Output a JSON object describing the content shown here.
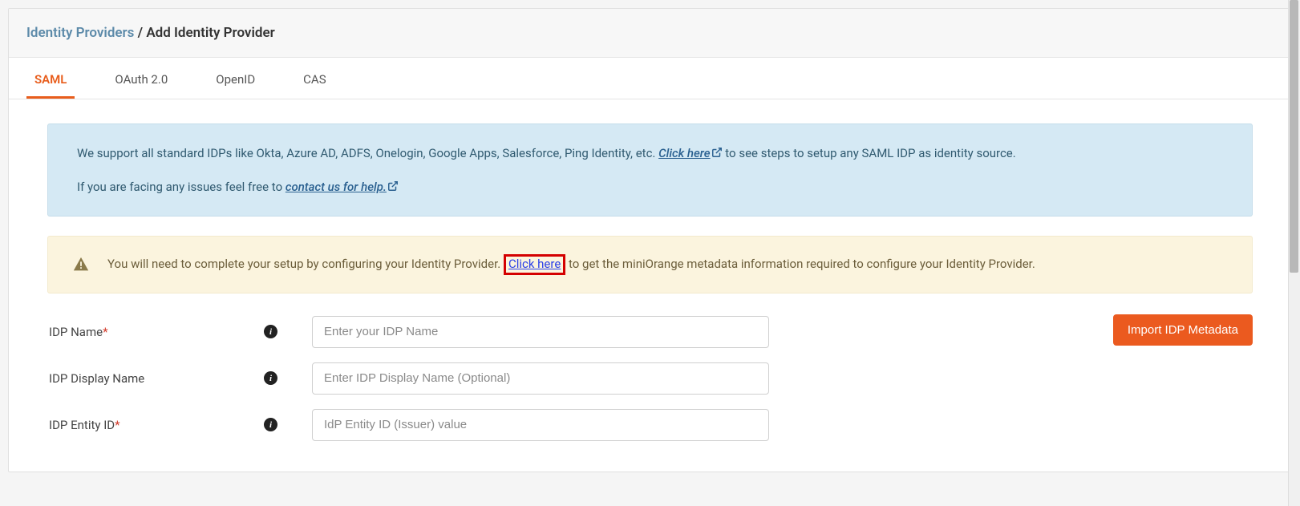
{
  "breadcrumb": {
    "parent": "Identity Providers",
    "sep": " / ",
    "current": "Add Identity Provider"
  },
  "tabs": {
    "saml": "SAML",
    "oauth": "OAuth 2.0",
    "openid": "OpenID",
    "cas": "CAS"
  },
  "info_alert": {
    "line1_a": "We support all standard IDPs like Okta, Azure AD, ADFS, Onelogin, Google Apps, Salesforce, Ping Identity, etc. ",
    "line1_link": "Click here",
    "line1_b": " to see steps to setup any SAML IDP as identity source.",
    "line2_a": "If you are facing any issues feel free to ",
    "line2_link": "contact us for help."
  },
  "warn_alert": {
    "text_a": "You will need to complete your setup by configuring your Identity Provider. ",
    "link": "Click here",
    "text_b": " to get the miniOrange metadata information required to configure your Identity Provider."
  },
  "form": {
    "idp_name_label": "IDP Name",
    "idp_name_placeholder": "Enter your IDP Name",
    "idp_display_label": "IDP Display Name",
    "idp_display_placeholder": "Enter IDP Display Name (Optional)",
    "idp_entity_label": "IDP Entity ID",
    "idp_entity_placeholder": "IdP Entity ID (Issuer) value",
    "required_mark": "*"
  },
  "buttons": {
    "import_metadata": "Import IDP Metadata"
  }
}
